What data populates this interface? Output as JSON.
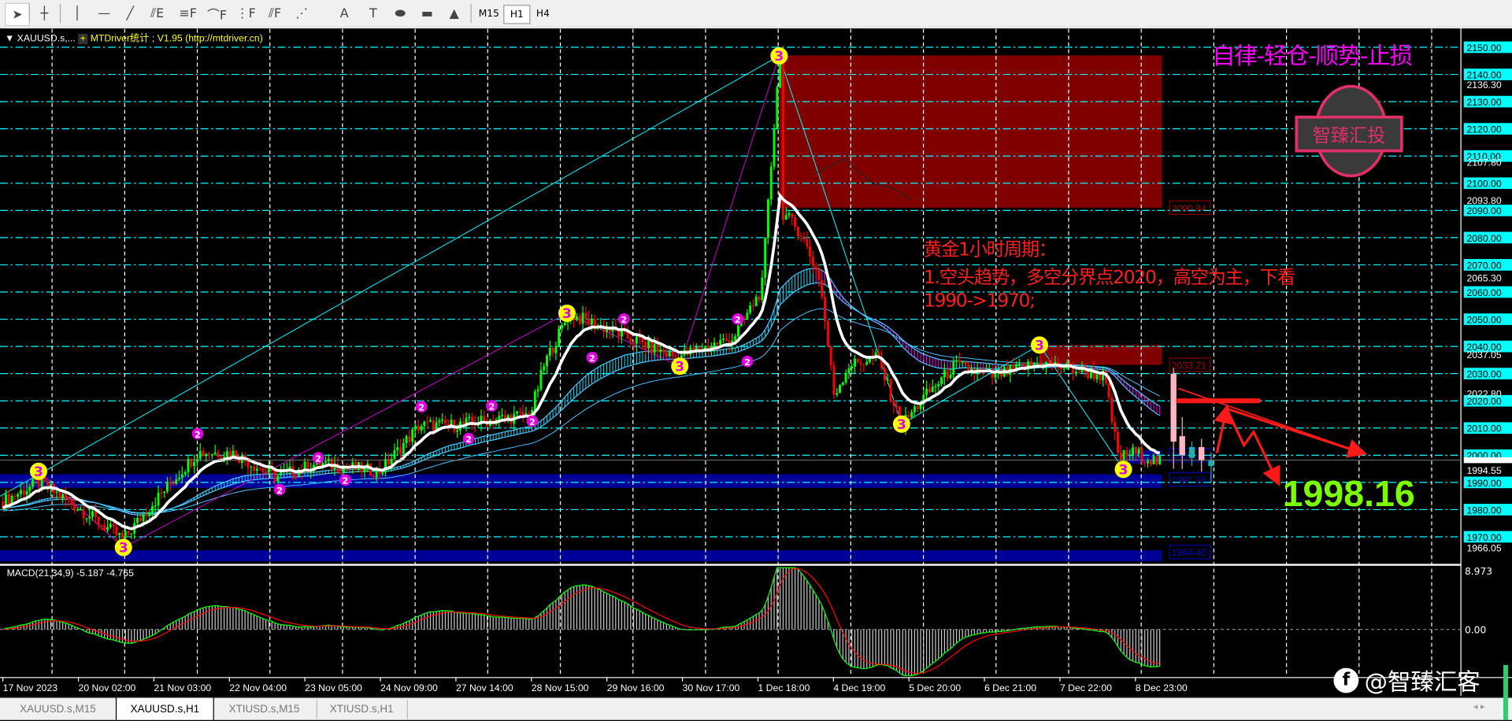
{
  "toolbar": {
    "tools": [
      {
        "name": "cursor-icon",
        "glyph": "➤"
      },
      {
        "name": "crosshair-icon",
        "glyph": "┼"
      },
      {
        "name": "vertical-line-icon",
        "glyph": "│"
      },
      {
        "name": "horizontal-line-icon",
        "glyph": "—"
      },
      {
        "name": "trendline-icon",
        "glyph": "╱"
      },
      {
        "name": "equidistant-channel-icon",
        "glyph": "⫽E"
      },
      {
        "name": "fibo-retracement-icon",
        "glyph": "≡F"
      },
      {
        "name": "fibo-fan-icon",
        "glyph": "⌒F"
      },
      {
        "name": "fibo-timezones-icon",
        "glyph": "⋮F"
      },
      {
        "name": "fibo-channel-icon",
        "glyph": "⫽F"
      },
      {
        "name": "gann-fan-icon",
        "glyph": "⋰"
      },
      {
        "name": "text-icon",
        "glyph": "A"
      },
      {
        "name": "text-label-icon",
        "glyph": "T"
      },
      {
        "name": "ellipse-icon",
        "glyph": "⬬"
      },
      {
        "name": "rectangle-icon",
        "glyph": "▬"
      },
      {
        "name": "triangle-icon",
        "glyph": "▲"
      }
    ],
    "timeframes": [
      "M15",
      "H1",
      "H4"
    ],
    "active_timeframe": "H1"
  },
  "chart": {
    "symbol": "XAUUSD.s,...",
    "indicator_label": "MTDriver统计 ; V1.95 (http://mtdriver.cn)",
    "motto": "自律-轻仓-顺势-止损",
    "stamp_text": "智臻汇投",
    "stamp_ring": "checked",
    "notes": [
      "黄金1小时周期：",
      "1.空头趋势，多空分界点2020，高空为主，下看",
      "1990->1970;"
    ],
    "big_price": "1998.16",
    "watermark": "@智臻汇客",
    "zone_labels": {
      "upper_supply": "2090.84",
      "lower_supply": "2033.21",
      "demand_small": "2001.75",
      "demand_main": "1991.16",
      "demand_low": "1964.40"
    },
    "colors": {
      "bull": "#00ff00",
      "bear": "#ff0000",
      "grid": "#00ffff",
      "supply_zone": "#800000",
      "demand_zone": "#000099",
      "note": "#ff2020",
      "motto": "#ff00ff",
      "big_price": "#7cfc00"
    }
  },
  "price_axis": {
    "levels": [
      "2150.00",
      "2140.00",
      "2130.00",
      "2120.00",
      "2110.00",
      "2100.00",
      "2090.00",
      "2080.00",
      "2070.00",
      "2060.00",
      "2050.00",
      "2040.00",
      "2030.00",
      "2020.00",
      "2010.00",
      "2000.00",
      "1990.00",
      "1980.00",
      "1970.00"
    ],
    "extra": [
      "2136.30",
      "2107.80",
      "2093.80",
      "2065.30",
      "2037.05",
      "2022.80",
      "1994.55",
      "1966.05"
    ],
    "current": "1998.16"
  },
  "macd": {
    "label": "MACD(21,34,9) -5.187 -4.765",
    "max_label": "8.973",
    "zero_label": "0.00"
  },
  "time_axis": [
    "17 Nov 2023",
    "20 Nov 02:00",
    "21 Nov 03:00",
    "22 Nov 04:00",
    "23 Nov 05:00",
    "24 Nov 09:00",
    "27 Nov 14:00",
    "28 Nov 15:00",
    "29 Nov 16:00",
    "30 Nov 17:00",
    "1 Dec 18:00",
    "4 Dec 19:00",
    "5 Dec 20:00",
    "6 Dec 21:00",
    "7 Dec 22:00",
    "8 Dec 23:00"
  ],
  "tabs": [
    {
      "label": "XAUUSD.s,M15"
    },
    {
      "label": "XAUUSD.s,H1",
      "active": true
    },
    {
      "label": "XTIUSD.s,M15"
    },
    {
      "label": "XTIUSD.s,H1"
    }
  ],
  "chart_data": {
    "type": "candlestick",
    "ylim": [
      1961,
      2152
    ],
    "price_path": [
      {
        "t": "17 Nov 00:00",
        "p": 1983
      },
      {
        "t": "17 Nov 12:00",
        "p": 1990
      },
      {
        "t": "20 Nov 02:00",
        "p": 1981
      },
      {
        "t": "20 Nov 17:00",
        "p": 1969
      },
      {
        "t": "21 Nov 01:00",
        "p": 1981
      },
      {
        "t": "21 Nov 18:00",
        "p": 2001
      },
      {
        "t": "22 Nov 05:00",
        "p": 2001
      },
      {
        "t": "22 Nov 19:00",
        "p": 1992
      },
      {
        "t": "23 Nov 10:00",
        "p": 1997
      },
      {
        "t": "24 Nov 10:00",
        "p": 1994
      },
      {
        "t": "24 Nov 22:00",
        "p": 2011
      },
      {
        "t": "27 Nov 14:00",
        "p": 2011
      },
      {
        "t": "28 Nov 16:00",
        "p": 2015
      },
      {
        "t": "28 Nov 21:00",
        "p": 2034
      },
      {
        "t": "29 Nov 05:00",
        "p": 2052
      },
      {
        "t": "29 Nov 21:00",
        "p": 2045
      },
      {
        "t": "30 Nov 17:00",
        "p": 2036
      },
      {
        "t": "1 Dec 10:00",
        "p": 2043
      },
      {
        "t": "1 Dec 19:00",
        "p": 2061
      },
      {
        "t": "4 Dec 01:00",
        "p": 2146
      },
      {
        "t": "4 Dec 02:00",
        "p": 2089
      },
      {
        "t": "4 Dec 08:00",
        "p": 2082
      },
      {
        "t": "4 Dec 14:00",
        "p": 2065
      },
      {
        "t": "4 Dec 18:00",
        "p": 2022
      },
      {
        "t": "4 Dec 23:00",
        "p": 2033
      },
      {
        "t": "5 Dec 09:00",
        "p": 2036
      },
      {
        "t": "5 Dec 17:00",
        "p": 2011
      },
      {
        "t": "6 Dec 01:00",
        "p": 2022
      },
      {
        "t": "6 Dec 11:00",
        "p": 2033
      },
      {
        "t": "6 Dec 23:00",
        "p": 2029
      },
      {
        "t": "7 Dec 14:00",
        "p": 2034
      },
      {
        "t": "8 Dec 04:00",
        "p": 2031
      },
      {
        "t": "8 Dec 12:00",
        "p": 2029
      },
      {
        "t": "8 Dec 16:00",
        "p": 1999
      },
      {
        "t": "8 Dec 21:00",
        "p": 2001
      },
      {
        "t": "11 Dec 08:00",
        "p": 1997
      }
    ],
    "zones": [
      {
        "type": "supply",
        "from": 2091,
        "to": 2147
      },
      {
        "type": "supply",
        "from": 2033.2,
        "to": 2040.5
      },
      {
        "type": "demand",
        "from": 1988,
        "to": 1993
      },
      {
        "type": "demand",
        "from": 1997,
        "to": 2001.75
      },
      {
        "type": "demand",
        "from": 1961,
        "to": 1965
      }
    ],
    "key_level": 2020
  }
}
